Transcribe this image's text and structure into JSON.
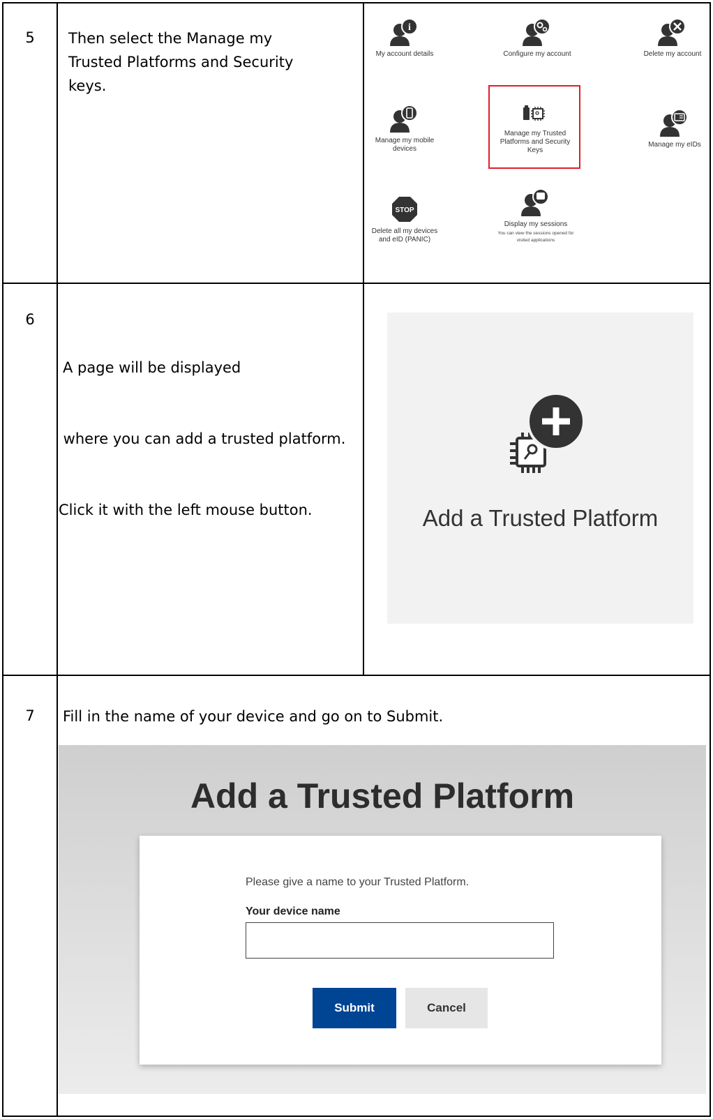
{
  "colors": {
    "highlight": "#e11d2a",
    "submit_bg": "#004494",
    "icon": "#333333"
  },
  "steps": [
    {
      "number": "5",
      "instruction_lines": [
        "Then select the Manage my",
        "Trusted Platforms and Security",
        "keys."
      ],
      "tiles": [
        {
          "icon": "user-info-icon",
          "label": "My account details"
        },
        {
          "icon": "user-gears-icon",
          "label": "Configure my account"
        },
        {
          "icon": "user-delete-icon",
          "label": "Delete my account"
        },
        {
          "icon": "user-mobile-icon",
          "label": "Manage my mobile devices"
        },
        {
          "icon": "usb-chip-icon",
          "label": "Manage my Trusted Platforms and Security Keys"
        },
        {
          "icon": "user-id-card-icon",
          "label": "Manage my eIDs"
        },
        {
          "icon": "stop-sign-icon",
          "label": "Delete all my devices and eID (PANIC)",
          "badge": "STOP"
        },
        {
          "icon": "user-session-icon",
          "label": "Display my sessions",
          "sublabel": "You can view the sessions opened for visited applications"
        }
      ]
    },
    {
      "number": "6",
      "instruction_lines": [
        "A page will be displayed",
        " where you can add a trusted platform.",
        "Click it with the left mouse button."
      ],
      "card_title": "Add a Trusted Platform"
    },
    {
      "number": "7",
      "instruction": "Fill in the name of your device and go on to Submit.",
      "form": {
        "title": "Add a Trusted Platform",
        "prompt": "Please give a name to your Trusted Platform.",
        "field_label": "Your device name",
        "field_value": "",
        "submit_label": "Submit",
        "cancel_label": "Cancel"
      }
    }
  ]
}
